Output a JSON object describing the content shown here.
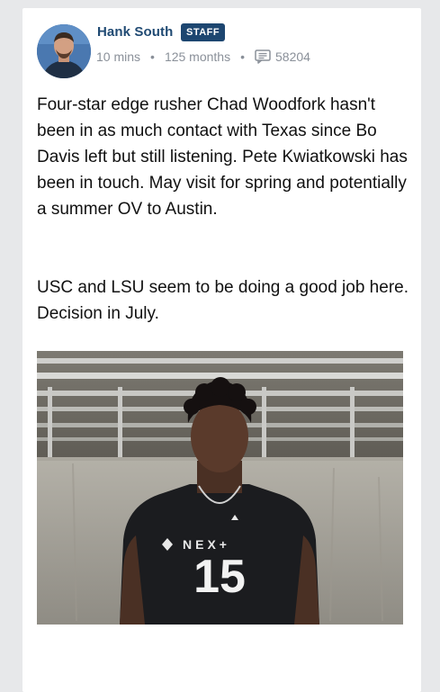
{
  "post": {
    "author": "Hank South",
    "badge": "STAFF",
    "time": "10 mins",
    "tenure": "125 months",
    "comment_count": "58204",
    "paragraphs": [
      "Four-star edge rusher Chad Woodfork hasn't been in as much contact with Texas since Bo Davis left but still listening. Pete Kwiatkowski has been in touch. May visit for spring and potentially a summer OV to Austin.",
      "USC and LSU seem to be doing a good job here. Decision in July."
    ],
    "image": {
      "jersey_brand": "NEX+",
      "jersey_number": "15"
    }
  },
  "colors": {
    "author": "#204a73",
    "badge_bg": "#1d4670",
    "meta": "#8a9099",
    "text": "#111111"
  },
  "icons": {
    "comments": "comment-bubble-icon"
  }
}
